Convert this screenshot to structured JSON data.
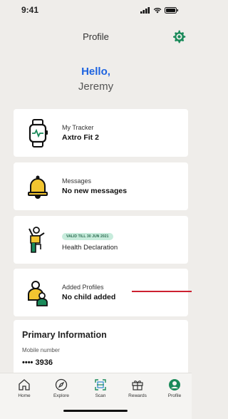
{
  "status_bar": {
    "time": "9:41"
  },
  "header": {
    "title": "Profile",
    "settings_icon": "gear-icon"
  },
  "greeting": {
    "hello": "Hello,",
    "name": "Jeremy"
  },
  "cards": [
    {
      "label": "My Tracker",
      "value": "Axtro Fit 2",
      "icon": "smartwatch-icon"
    },
    {
      "label": "Messages",
      "value": "No new messages",
      "icon": "bell-icon"
    },
    {
      "badge": "VALID TILL 30 JUN 2021",
      "value": "Health Declaration",
      "icon": "health-person-icon"
    },
    {
      "label": "Added Profiles",
      "value": "No child added",
      "icon": "family-icon"
    }
  ],
  "primary": {
    "title": "Primary Information",
    "mobile_label": "Mobile number",
    "mobile_value": "•••• 3936"
  },
  "tabs": [
    {
      "label": "Home",
      "icon": "home-icon"
    },
    {
      "label": "Explore",
      "icon": "compass-icon"
    },
    {
      "label": "Scan",
      "icon": "scan-icon"
    },
    {
      "label": "Rewards",
      "icon": "gift-icon"
    },
    {
      "label": "Profile",
      "icon": "profile-icon"
    }
  ],
  "colors": {
    "accent_green": "#1a8a5a",
    "hello_blue": "#1d63e0",
    "icon_yellow": "#f2c530",
    "annotation_red": "#cc2030"
  }
}
